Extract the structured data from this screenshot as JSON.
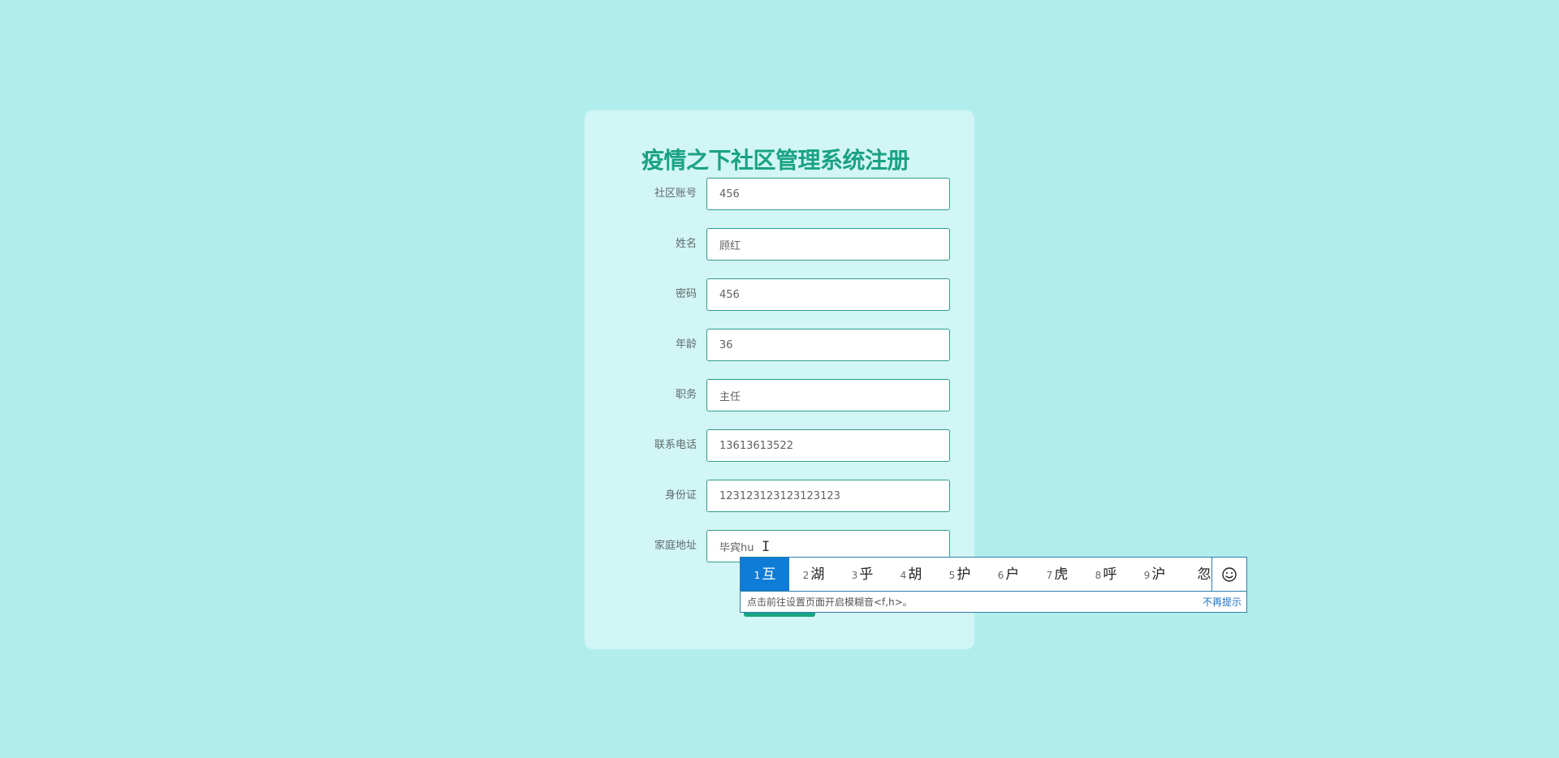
{
  "form": {
    "title": "疫情之下社区管理系统注册",
    "fields": [
      {
        "label": "社区账号",
        "value": "456"
      },
      {
        "label": "姓名",
        "value": "顾红"
      },
      {
        "label": "密码",
        "value": "456"
      },
      {
        "label": "年龄",
        "value": "36"
      },
      {
        "label": "职务",
        "value": "主任"
      },
      {
        "label": "联系电话",
        "value": "13613613522"
      },
      {
        "label": "身份证",
        "value": "123123123123123123"
      },
      {
        "label": "家庭地址",
        "value": "毕宾hu"
      }
    ]
  },
  "ime": {
    "candidates": [
      {
        "num": "1",
        "char": "互"
      },
      {
        "num": "2",
        "char": "湖"
      },
      {
        "num": "3",
        "char": "乎"
      },
      {
        "num": "4",
        "char": "胡"
      },
      {
        "num": "5",
        "char": "护"
      },
      {
        "num": "6",
        "char": "户"
      },
      {
        "num": "7",
        "char": "虎"
      },
      {
        "num": "8",
        "char": "呼"
      },
      {
        "num": "9",
        "char": "沪"
      },
      {
        "num": "",
        "char": "忽"
      }
    ],
    "emoji_icon": "smiley-icon",
    "hint": "点击前往设置页面开启模糊音<f,h>。",
    "dismiss": "不再提示"
  },
  "colors": {
    "background": "#b2eded",
    "card": "#d2f5f5",
    "accent": "#19a383",
    "ime_selected": "#0f7cd6",
    "ime_border": "#2f7ea8"
  }
}
